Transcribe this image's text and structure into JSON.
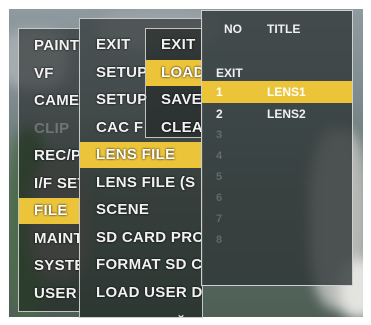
{
  "menu_level1": [
    "PAINT",
    "VF",
    "CAMERA",
    "CLIP",
    "REC/PB",
    "I/F SETUP",
    "FILE",
    "MAINTENANCE",
    "SYSTEM",
    "USER"
  ],
  "menu_level1_selected": "FILE",
  "menu_level1_dimmed": [
    "CLIP"
  ],
  "menu_level2": [
    "EXIT",
    "SETUP",
    "SETUP",
    "CAC F",
    "LENS FILE",
    "LENS FILE (S",
    "SCENE",
    "SD CARD PRO",
    "FORMAT SD C",
    "LOAD USER DATA"
  ],
  "menu_level2_selected": "LENS FILE",
  "menu_level3": [
    "EXIT",
    "LOAD",
    "SAVE",
    "CLEAR"
  ],
  "menu_level3_selected": "LOAD",
  "lens_list": {
    "header_no": "NO",
    "header_title": "TITLE",
    "exit_label": "EXIT",
    "rows": [
      {
        "no": "1",
        "title": "LENS1"
      },
      {
        "no": "2",
        "title": "LENS2"
      }
    ],
    "selected_no": "1",
    "empty_slots": [
      "3",
      "4",
      "5",
      "6",
      "7",
      "8"
    ]
  },
  "scroll_indicator": "⌄",
  "highlight_color": "#ecc43a"
}
